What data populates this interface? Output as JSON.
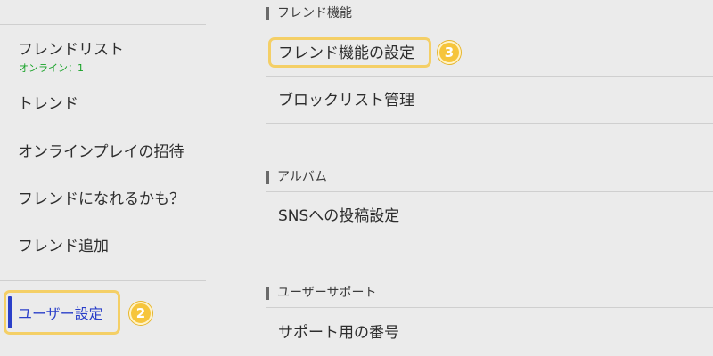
{
  "sidebar": {
    "items": [
      {
        "label": "フレンドリスト",
        "sub": "オンライン：1"
      },
      {
        "label": "トレンド"
      },
      {
        "label": "オンラインプレイの招待"
      },
      {
        "label": "フレンドになれるかも？"
      },
      {
        "label": "フレンド追加"
      }
    ],
    "selected": {
      "label": "ユーザー設定",
      "badge": "2"
    }
  },
  "main": {
    "sections": [
      {
        "title": "フレンド機能",
        "rows": [
          "フレンド機能の設定",
          "ブロックリスト管理"
        ],
        "badge": "3"
      },
      {
        "title": "アルバム",
        "rows": [
          "SNSへの投稿設定"
        ]
      },
      {
        "title": "ユーザーサポート",
        "rows": [
          "サポート用の番号"
        ]
      }
    ]
  },
  "colors": {
    "background": "#ebebeb",
    "selected_text": "#2a3fc9",
    "online_green": "#17a227",
    "highlight_border": "#f4cf66",
    "badge_fill": "#f6c53c"
  },
  "icons": {
    "badge_2": "circled-number-2-icon",
    "badge_3": "circled-number-3-icon"
  }
}
